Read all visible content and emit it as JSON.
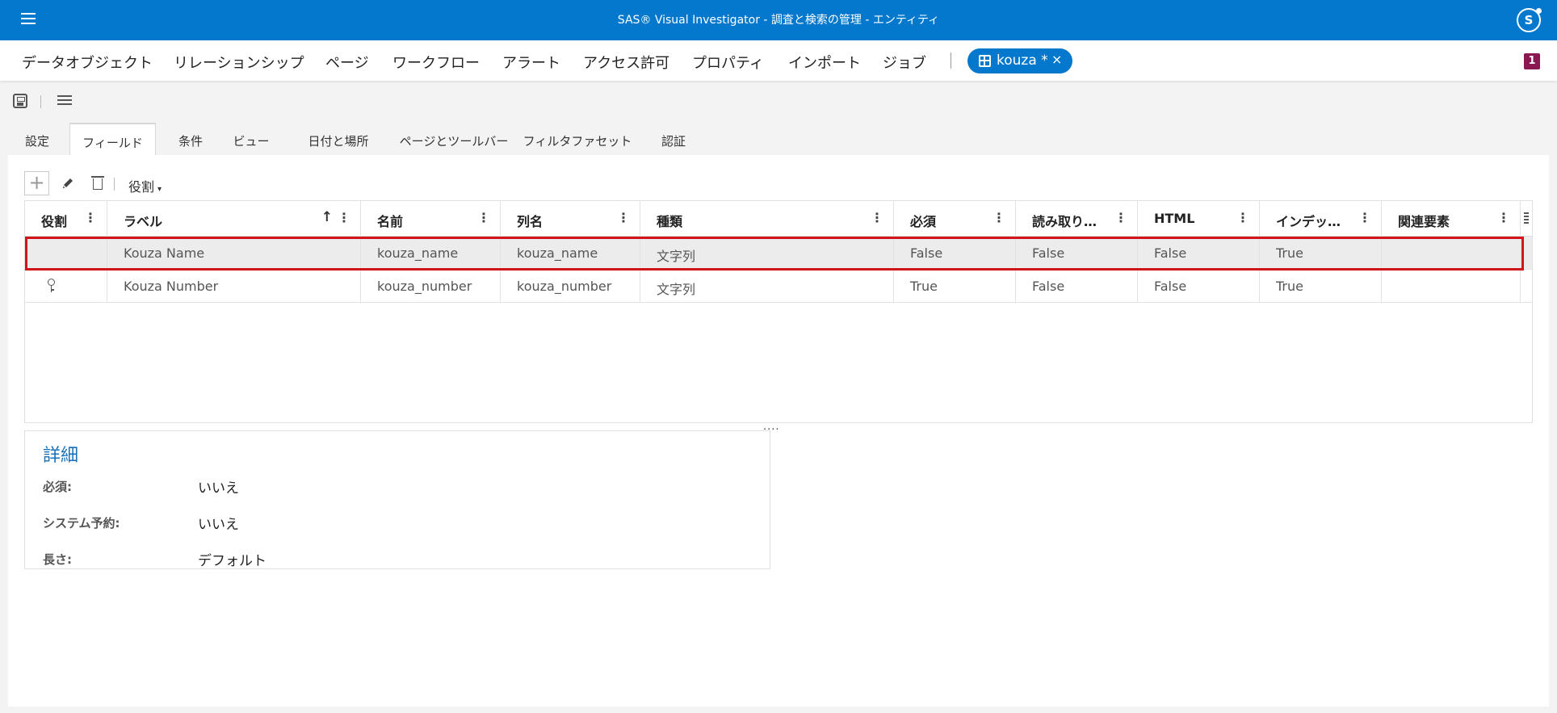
{
  "app": {
    "title": "SAS® Visual Investigator - 調査と検索の管理 - エンティティ",
    "user_initial": "S"
  },
  "menu": {
    "items": [
      "データオブジェクト",
      "リレーションシップ",
      "ページ",
      "ワークフロー",
      "アラート",
      "アクセス許可",
      "プロパティ",
      "インポート",
      "ジョブ"
    ],
    "open_tab": "kouza *",
    "close_glyph": "×",
    "notification_count": "1"
  },
  "tabs": [
    "設定",
    "フィールド",
    "条件",
    "ビュー",
    "日付と場所",
    "ページとツールバー",
    "フィルタファセット",
    "認証"
  ],
  "active_tab": "フィールド",
  "grid_toolbar": {
    "add_glyph": "+",
    "role_filter": "役割",
    "caret": "▾"
  },
  "grid": {
    "columns": [
      "役割",
      "ラベル",
      "名前",
      "列名",
      "種類",
      "必須",
      "読み取り…",
      "HTML",
      "インデッ…",
      "関連要素"
    ],
    "menu_glyph": "⋮",
    "sort_glyph": "↑",
    "rows": [
      {
        "role_icon": "",
        "label": "Kouza Name",
        "name": "kouza_name",
        "column_name": "kouza_name",
        "type": "文字列",
        "required": "False",
        "read_only": "False",
        "html": "False",
        "indexed": "True",
        "related": "",
        "selected": true
      },
      {
        "role_icon": "key-icon",
        "label": "Kouza Number",
        "name": "kouza_number",
        "column_name": "kouza_number",
        "type": "文字列",
        "required": "True",
        "read_only": "False",
        "html": "False",
        "indexed": "True",
        "related": "",
        "selected": false
      }
    ],
    "splitter_glyph": "...."
  },
  "details": {
    "title": "詳細",
    "items": [
      {
        "label": "必須:",
        "value": "いいえ"
      },
      {
        "label": "システム予約:",
        "value": "いいえ"
      },
      {
        "label": "長さ:",
        "value": "デフォルト"
      }
    ]
  },
  "colors": {
    "brand_blue": "#0378cd",
    "selection_outline": "#d2141c",
    "badge": "#8a1952",
    "details_title": "#1a6fb6"
  }
}
